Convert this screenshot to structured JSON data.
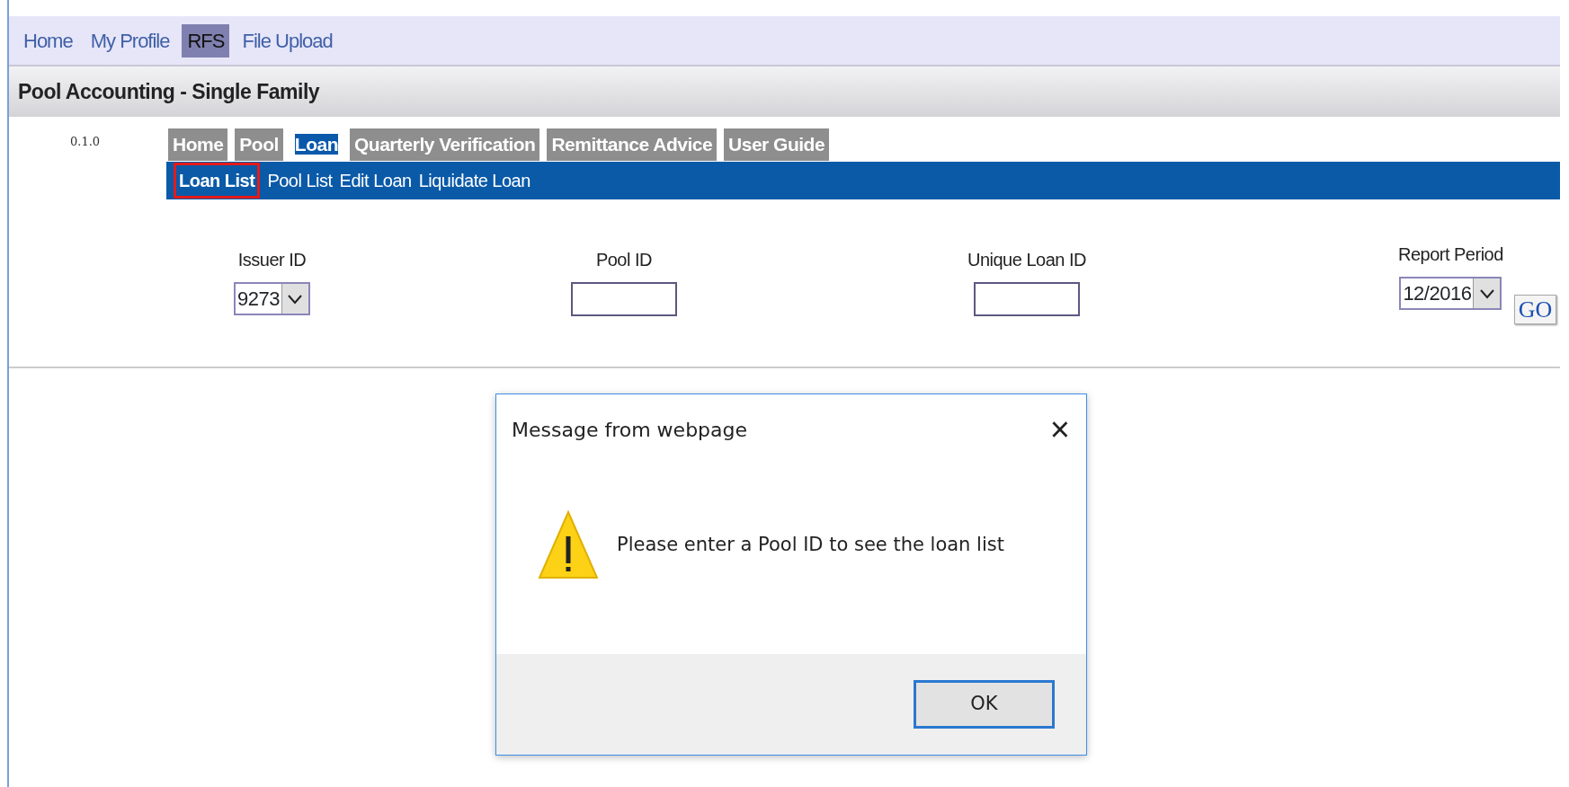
{
  "top_nav": [
    {
      "label": "Home",
      "selected": false
    },
    {
      "label": "My Profile",
      "selected": false
    },
    {
      "label": "RFS",
      "selected": true
    },
    {
      "label": "File Upload",
      "selected": false
    }
  ],
  "page_title": "Pool Accounting - Single Family",
  "version": "0.1.0",
  "tabs": [
    {
      "label": "Home",
      "selected": false
    },
    {
      "label": "Pool",
      "selected": false
    },
    {
      "label": "Loan",
      "selected": true
    },
    {
      "label": "Quarterly Verification",
      "selected": false
    },
    {
      "label": "Remittance Advice",
      "selected": false
    },
    {
      "label": "User Guide",
      "selected": false
    }
  ],
  "sub_nav": [
    {
      "label": "Loan List",
      "selected": true
    },
    {
      "label": "Pool List",
      "selected": false
    },
    {
      "label": "Edit Loan",
      "selected": false
    },
    {
      "label": "Liquidate Loan",
      "selected": false
    }
  ],
  "filters": [
    {
      "kind": "select",
      "label": "Issuer ID",
      "value": "9273"
    },
    {
      "kind": "input",
      "label": "Pool ID"
    },
    {
      "kind": "input",
      "label": "Unique Loan ID"
    },
    {
      "kind": "select",
      "label": "Report Period",
      "value": "12/2016"
    }
  ],
  "go_button": "GO",
  "dialog": {
    "title": "Message from webpage",
    "close": "×",
    "message": "Please enter a Pool ID to see the loan list",
    "button": "OK"
  }
}
